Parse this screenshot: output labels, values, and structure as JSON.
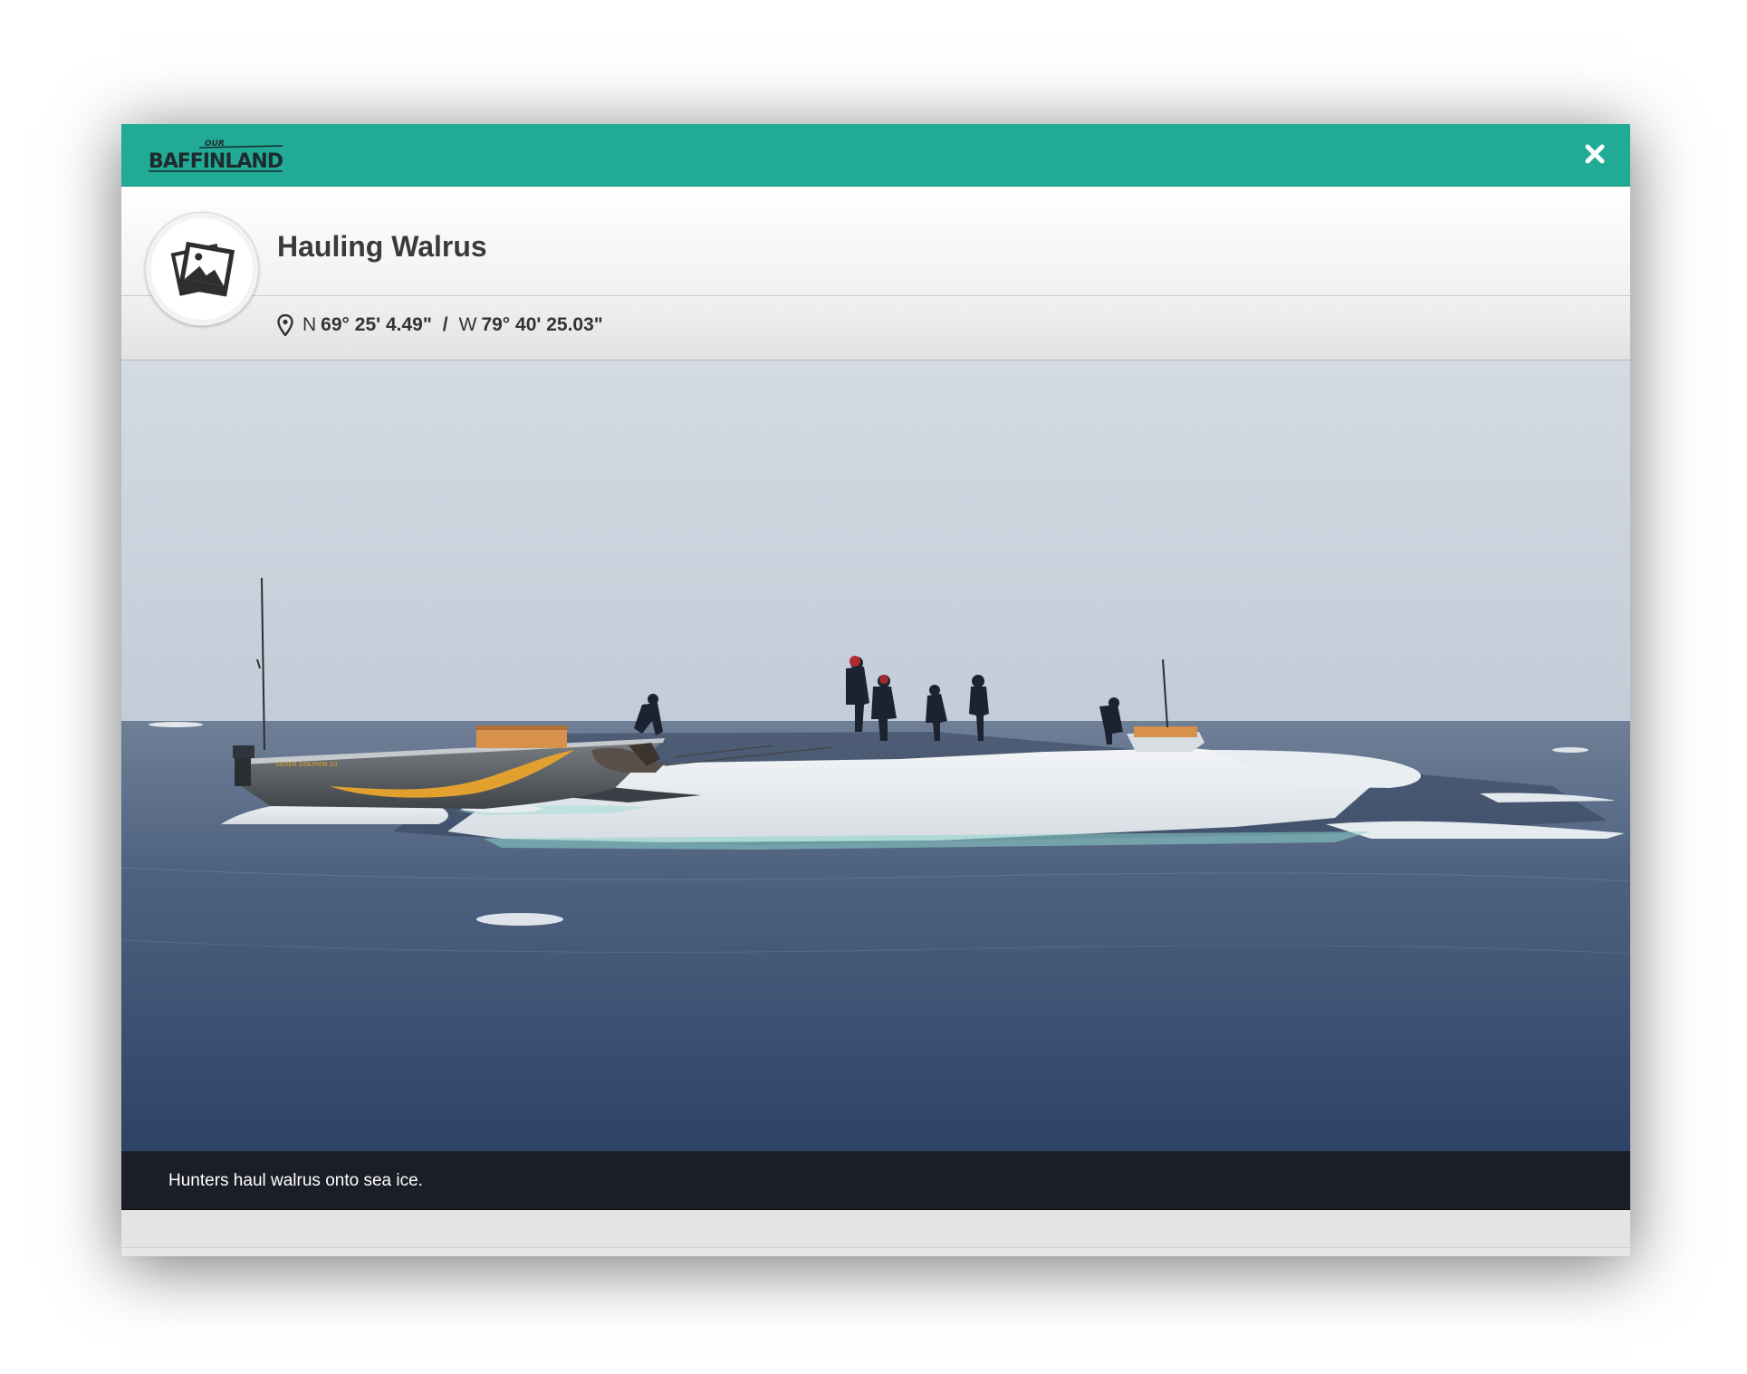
{
  "header": {
    "logo_top": "OUR",
    "logo_main": "BAFFINLAND",
    "close_icon": "close-icon",
    "accent_color": "#21ab97"
  },
  "item": {
    "type_icon": "photo-icon",
    "title": "Hauling Walrus",
    "location_icon": "map-pin-icon",
    "lat_hemisphere": "N",
    "lat_value": "69° 25' 4.49\"",
    "separator": "/",
    "lon_hemisphere": "W",
    "lon_value": "79° 40' 25.03\""
  },
  "photo": {
    "caption": "Hunters haul walrus onto sea ice."
  }
}
